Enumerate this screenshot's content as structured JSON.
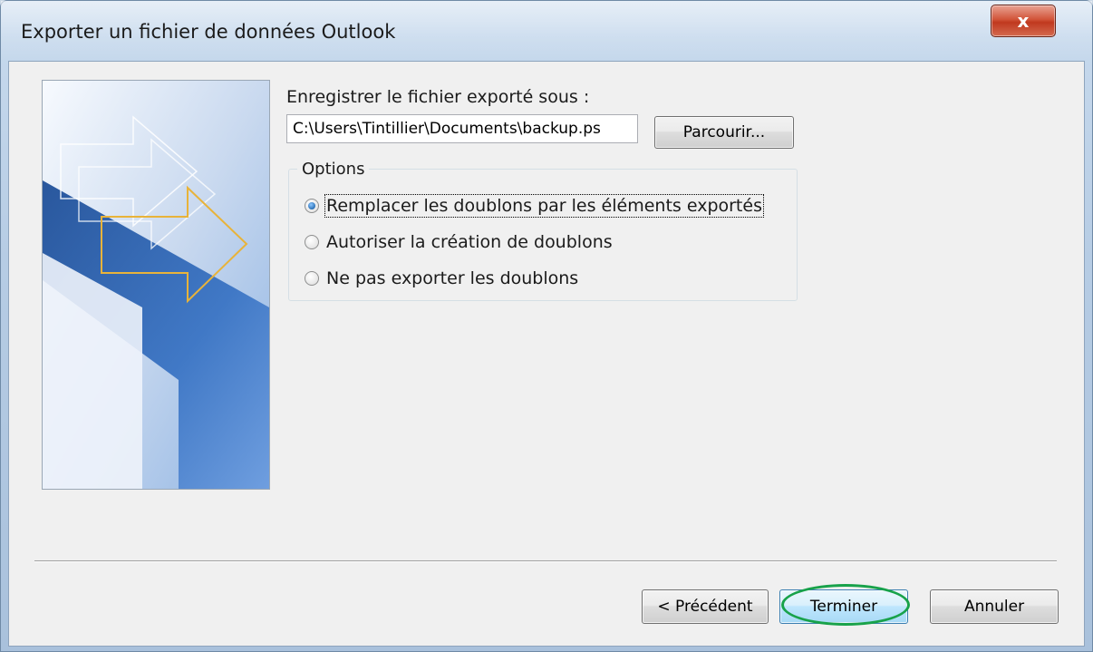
{
  "window": {
    "title": "Exporter un fichier de données Outlook",
    "close_label": "x"
  },
  "form": {
    "save_as_label": "Enregistrer le fichier exporté sous :",
    "path_value": "C:\\Users\\Tintillier\\Documents\\backup.ps",
    "browse_label": "Parcourir...",
    "options_legend": "Options",
    "options": [
      {
        "label": "Remplacer les doublons par les éléments exportés",
        "checked": true
      },
      {
        "label": "Autoriser la création de doublons",
        "checked": false
      },
      {
        "label": "Ne pas exporter les doublons",
        "checked": false
      }
    ]
  },
  "footer": {
    "previous_label": "< Précédent",
    "finish_label": "Terminer",
    "cancel_label": "Annuler"
  },
  "colors": {
    "highlight": "#18a24a",
    "banner_blue": "#2b63b2",
    "arrow_gold": "#e8b33a"
  }
}
